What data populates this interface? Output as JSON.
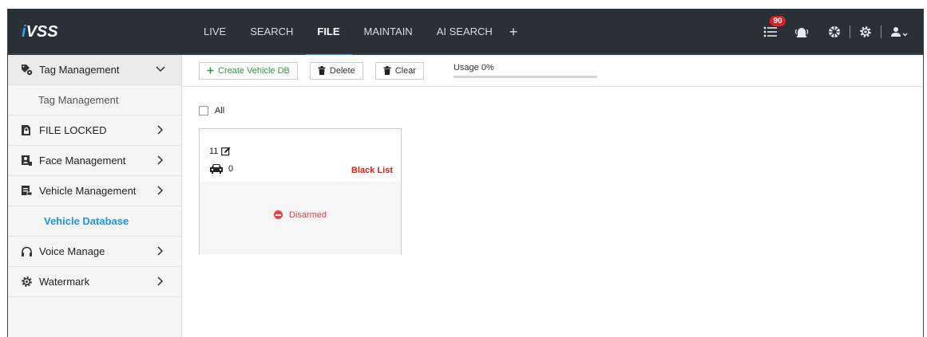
{
  "app": {
    "logo_prefix": "i",
    "logo_rest": "VSS"
  },
  "nav": {
    "tabs": [
      "LIVE",
      "SEARCH",
      "FILE",
      "MAINTAIN",
      "AI SEARCH"
    ],
    "active_tab": "FILE",
    "plus": "+"
  },
  "topbar": {
    "notification_count": "90"
  },
  "sidebar": {
    "tag_management": "Tag Management",
    "tag_management_sub": "Tag Management",
    "file_locked": "FILE LOCKED",
    "face_management": "Face Management",
    "vehicle_management": "Vehicle Management",
    "vehicle_database": "Vehicle Database",
    "voice_manage": "Voice Manage",
    "watermark": "Watermark"
  },
  "toolbar": {
    "create_label": "Create Vehicle DB",
    "delete_label": "Delete",
    "clear_label": "Clear",
    "usage_label": "Usage 0%",
    "usage_fraction": 0
  },
  "list": {
    "all_label": "All"
  },
  "card": {
    "id": "11",
    "count": "0",
    "list_type": "Black List",
    "status": "Disarmed"
  },
  "colors": {
    "accent": "#1ba6ef",
    "topbar": "#2b2f38",
    "danger": "#e01b1b",
    "create_green": "#2e9a3c"
  }
}
